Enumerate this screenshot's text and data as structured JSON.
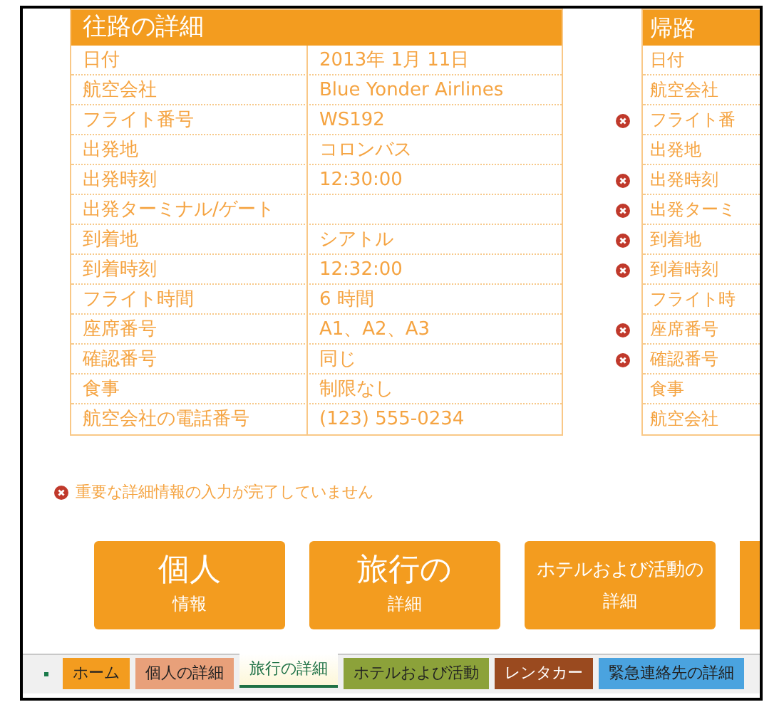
{
  "outbound": {
    "title": "往路の詳細",
    "rows": [
      {
        "label": "日付",
        "value": "2013年 1月 11日"
      },
      {
        "label": "航空会社",
        "value": "Blue Yonder Airlines"
      },
      {
        "label": "フライト番号",
        "value": "WS192"
      },
      {
        "label": "出発地",
        "value": "コロンバス"
      },
      {
        "label": "出発時刻",
        "value": "12:30:00"
      },
      {
        "label": "出発ターミナル/ゲート",
        "value": ""
      },
      {
        "label": "到着地",
        "value": "シアトル"
      },
      {
        "label": "到着時刻",
        "value": "12:32:00"
      },
      {
        "label": "フライト時間",
        "value": "6 時間"
      },
      {
        "label": "座席番号",
        "value": "A1、A2、A3"
      },
      {
        "label": "確認番号",
        "value": "同じ"
      },
      {
        "label": "食事",
        "value": "制限なし"
      },
      {
        "label": "航空会社の電話番号",
        "value": "(123) 555-0234"
      }
    ]
  },
  "return": {
    "title": "帰路",
    "rows": [
      {
        "label": "日付",
        "error": false
      },
      {
        "label": "航空会社",
        "error": false
      },
      {
        "label": "フライト番",
        "error": true
      },
      {
        "label": "出発地",
        "error": false
      },
      {
        "label": "出発時刻",
        "error": true
      },
      {
        "label": "出発ターミ",
        "error": true
      },
      {
        "label": "到着地",
        "error": true
      },
      {
        "label": "到着時刻",
        "error": true
      },
      {
        "label": "フライト時",
        "error": false
      },
      {
        "label": "座席番号",
        "error": true
      },
      {
        "label": "確認番号",
        "error": true
      },
      {
        "label": "食事",
        "error": false
      },
      {
        "label": "航空会社",
        "error": false
      }
    ]
  },
  "warning": "重要な詳細情報の入力が完了していません",
  "nav_tiles": [
    {
      "big": "個人",
      "small": "情報"
    },
    {
      "big": "旅行の",
      "small": "詳細"
    },
    {
      "big": "ホテルおよび活動の",
      "small": "詳細"
    }
  ],
  "sheet_tabs": [
    {
      "label": "ホーム",
      "color": "#f39c1f",
      "selected": false
    },
    {
      "label": "個人の詳細",
      "color": "#e8a07a",
      "selected": false
    },
    {
      "label": "旅行の詳細",
      "color": "#fdf7d8",
      "selected": true
    },
    {
      "label": "ホテルおよび活動",
      "color": "#8ca23a",
      "selected": false
    },
    {
      "label": "レンタカー",
      "color": "#9a4a1f",
      "selected": false
    },
    {
      "label": "緊急連絡先の詳細",
      "color": "#4aa3df",
      "selected": false
    }
  ]
}
